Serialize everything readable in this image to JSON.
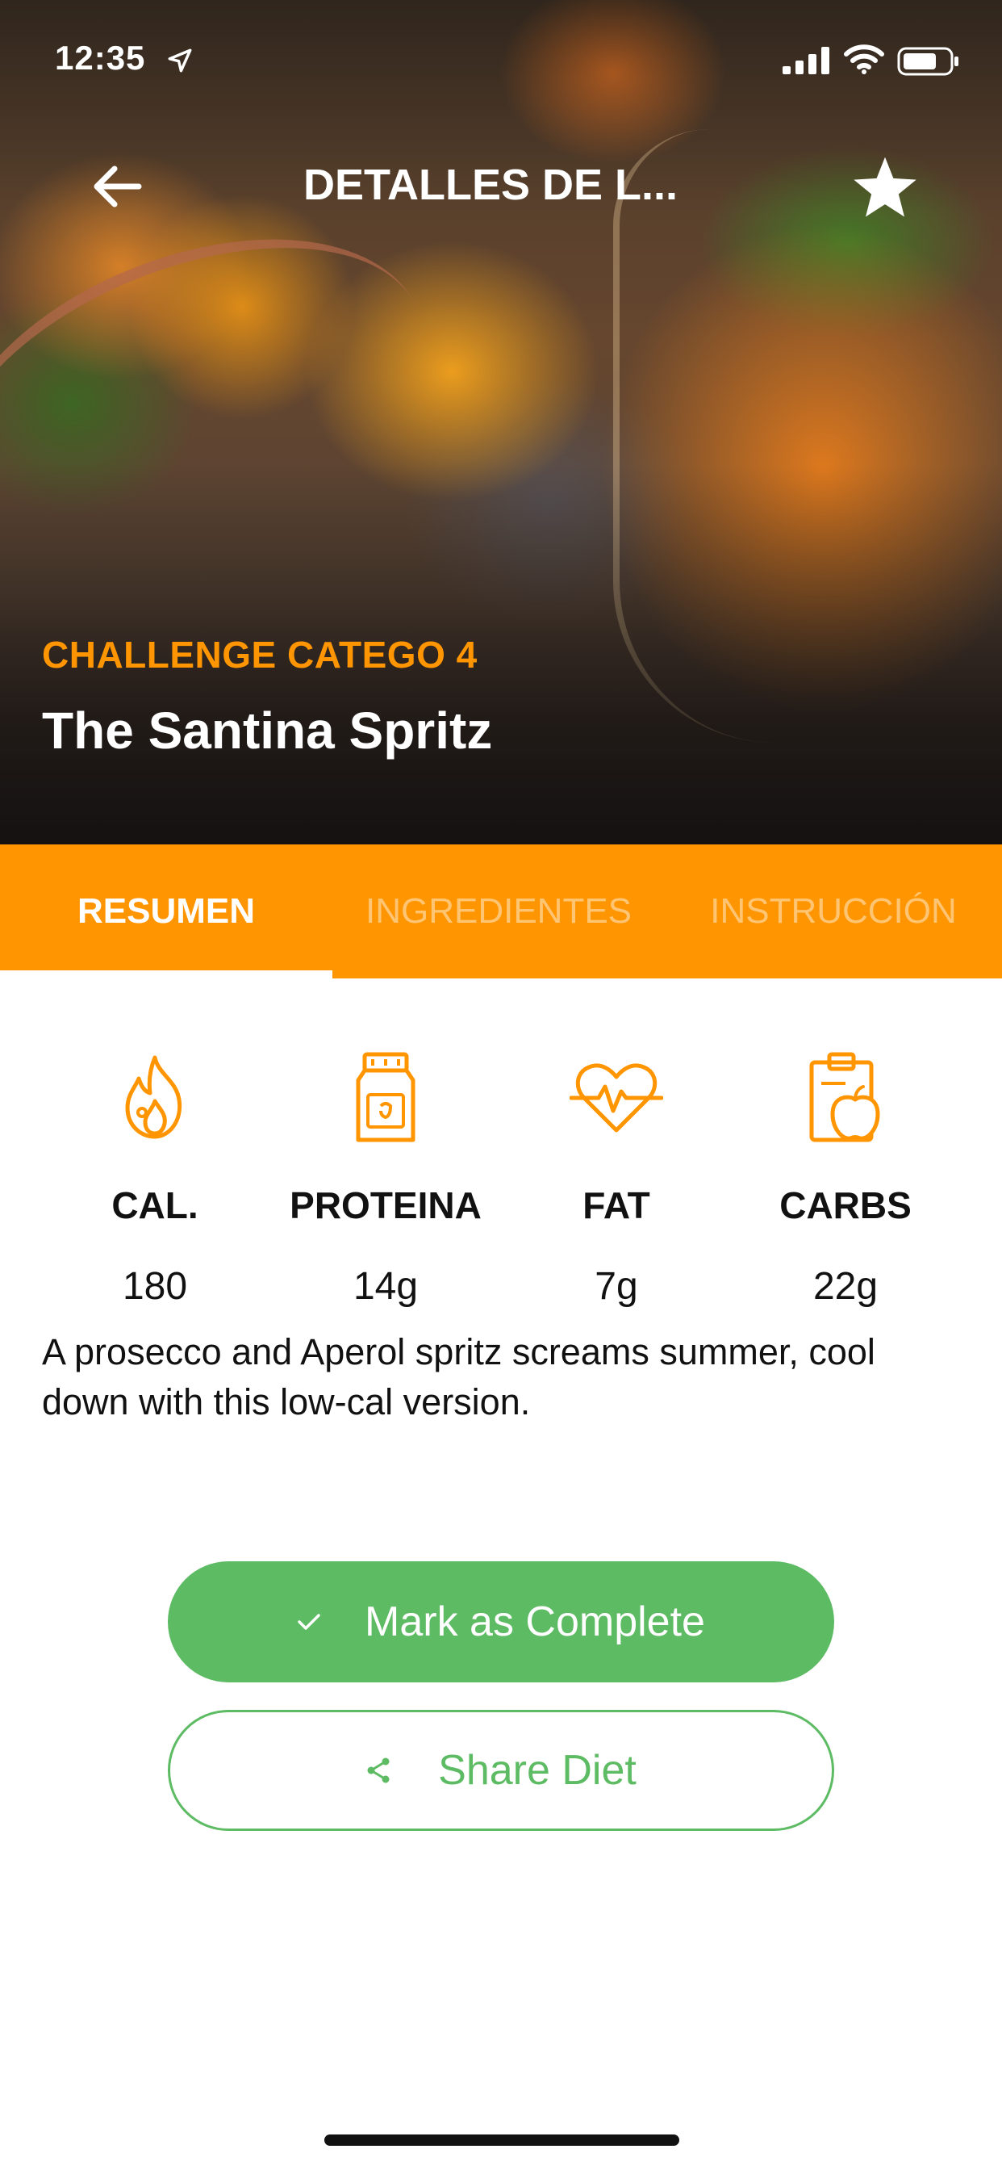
{
  "status_bar": {
    "time": "12:35"
  },
  "header": {
    "title": "DETALLES DE L..."
  },
  "recipe": {
    "category": "CHALLENGE CATEGO 4",
    "title": "The Santina Spritz"
  },
  "tabs": [
    {
      "label": "RESUMEN",
      "active": true
    },
    {
      "label": "INGREDIENTES",
      "active": false
    },
    {
      "label": "INSTRUCCIÓN",
      "active": false
    }
  ],
  "nutrition": [
    {
      "label": "CAL.",
      "value": "180",
      "icon": "flame-icon"
    },
    {
      "label": "PROTEINA",
      "value": "14g",
      "icon": "protein-jar-icon"
    },
    {
      "label": "FAT",
      "value": "7g",
      "icon": "heartbeat-icon"
    },
    {
      "label": "CARBS",
      "value": "22g",
      "icon": "clipboard-apple-icon"
    }
  ],
  "description": "A prosecco and Aperol spritz screams summer, cool down with this low-cal version.",
  "actions": {
    "complete_label": "Mark as Complete",
    "share_label": "Share Diet"
  },
  "colors": {
    "accent": "#ff9500",
    "success": "#5dbb63",
    "text": "#111111"
  }
}
